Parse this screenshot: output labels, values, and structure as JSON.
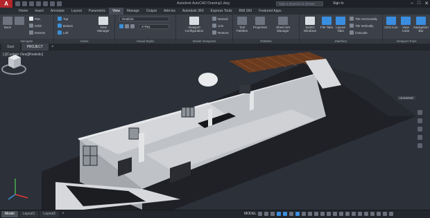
{
  "title_bar": {
    "app_logo": "A",
    "doc_title": "Autodesk AutoCAD   Drawing1.dwg",
    "search_placeholder": "Type a keyword or phrase",
    "user": "Sign In",
    "controls": [
      "–",
      "□",
      "✕"
    ]
  },
  "ribbon_tabs": [
    {
      "label": "Home",
      "active": false
    },
    {
      "label": "Insert",
      "active": false
    },
    {
      "label": "Annotate",
      "active": false
    },
    {
      "label": "Layout",
      "active": false
    },
    {
      "label": "Parametric",
      "active": false
    },
    {
      "label": "View",
      "active": true
    },
    {
      "label": "Manage",
      "active": false
    },
    {
      "label": "Output",
      "active": false
    },
    {
      "label": "Add-ins",
      "active": false
    },
    {
      "label": "Autodesk 360",
      "active": false
    },
    {
      "label": "Express Tools",
      "active": false
    },
    {
      "label": "BIM 360",
      "active": false
    },
    {
      "label": "Featured Apps",
      "active": false
    }
  ],
  "ribbon": {
    "navigate": {
      "label": "Navigate",
      "back": "Back",
      "forward": "Forward",
      "pan": "Pan",
      "orbit": "Orbit",
      "extents": "Extents"
    },
    "views": {
      "label": "Views",
      "top": "Top",
      "bottom": "Bottom",
      "left": "Left",
      "view_manager": "View Manager"
    },
    "visual_styles": {
      "label": "Visual Styles",
      "current": "Realistic",
      "sub": "X-Ray"
    },
    "model_viewports": {
      "label": "Model Viewports",
      "viewport_config": "Viewport Configuration",
      "named": "Named",
      "join": "Join",
      "restore": "Restore"
    },
    "palettes": {
      "label": "Palettes",
      "tool_palettes": "Tool Palettes",
      "properties": "Properties",
      "sheet_set": "Sheet Set Manager"
    },
    "interface": {
      "label": "Interface",
      "switch_windows": "Switch Windows",
      "file_tabs": "File Tabs",
      "layout_tabs": "Layout Tabs",
      "tile_horizontally": "Tile Horizontally",
      "tile_vertically": "Tile Vertically",
      "cascade": "Cascade"
    },
    "viewport_tools": {
      "label": "Viewport Tools",
      "ucs_icon": "UCS Icon",
      "view_cube": "View Cube",
      "navigation_bar": "Navigation Bar"
    }
  },
  "file_tabs": [
    {
      "label": "Start",
      "active": false
    },
    {
      "label": "PROJECT",
      "active": true
    }
  ],
  "viewport": {
    "label": "[-][Custom View][Realistic]",
    "view_name": "Unnamed"
  },
  "status_bar": {
    "layout_tabs": [
      {
        "label": "Model",
        "active": true
      },
      {
        "label": "Layout1",
        "active": false
      },
      {
        "label": "Layout2",
        "active": false
      }
    ],
    "model_label": "MODEL"
  }
}
